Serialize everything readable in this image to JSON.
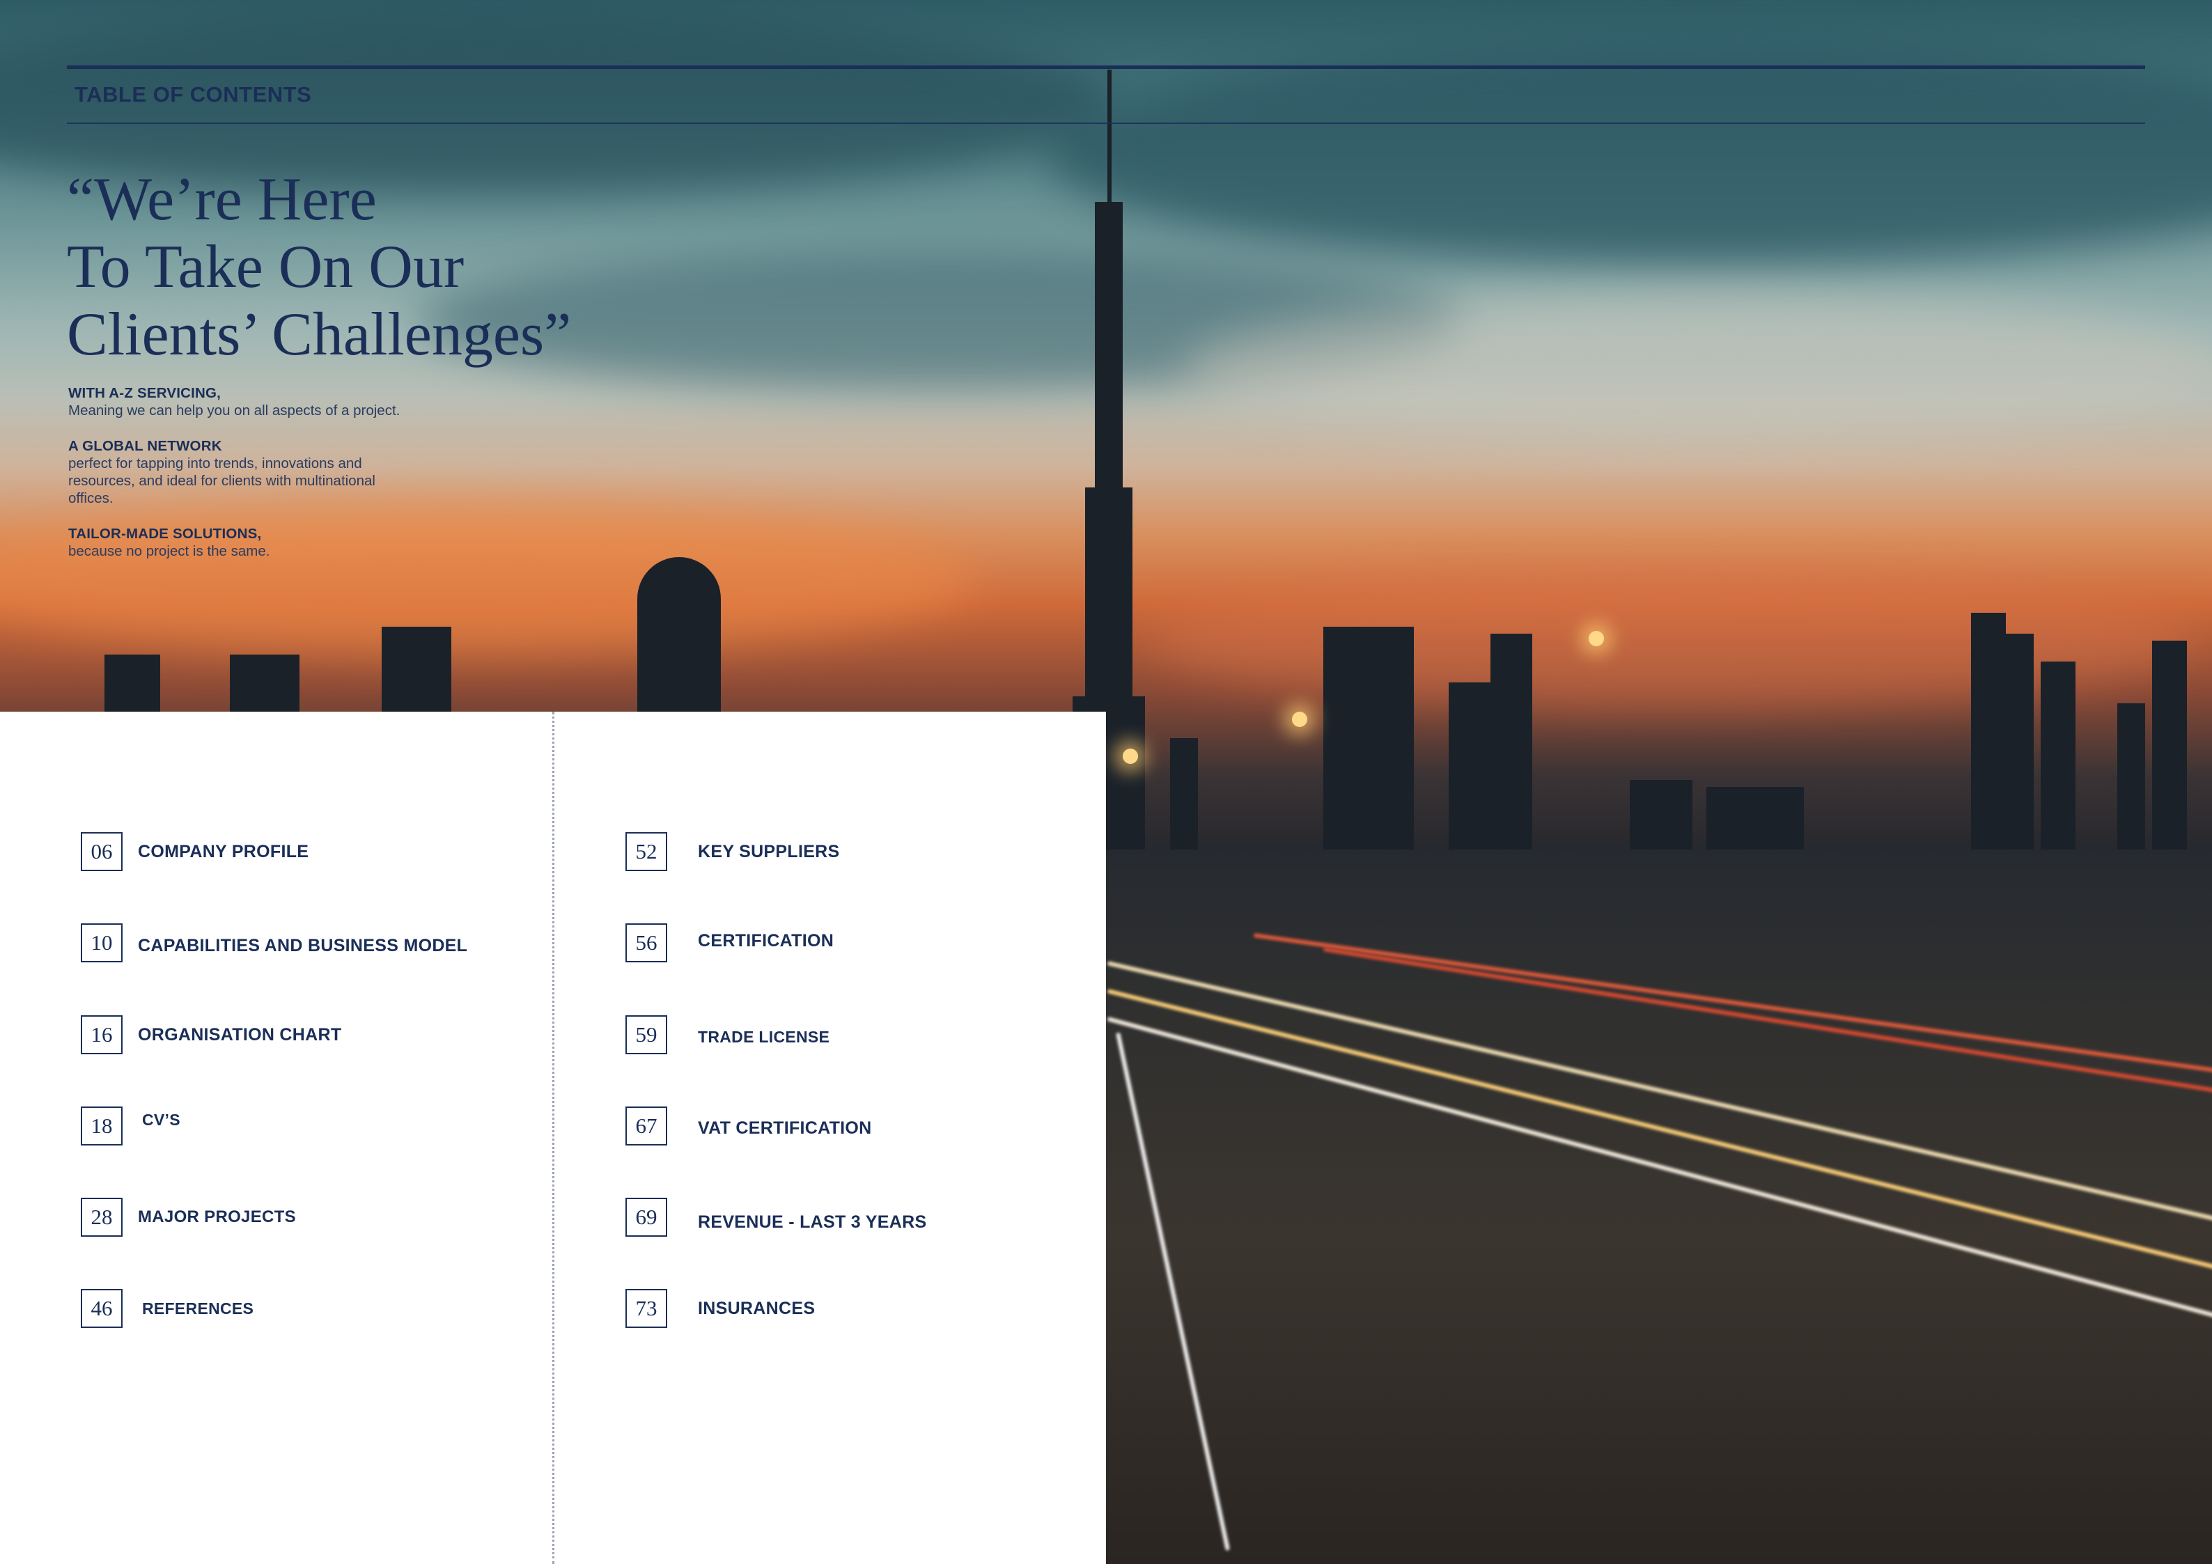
{
  "header": {
    "title": "TABLE OF CONTENTS"
  },
  "headline": {
    "lines": [
      "“We’re Here",
      "To Take On Our",
      "Clients’ Challenges”"
    ]
  },
  "features": [
    {
      "title": "WITH A-Z SERVICING,",
      "lines": [
        "Meaning we can help  you on all aspects of a project."
      ]
    },
    {
      "title": "A GLOBAL NETWORK",
      "lines": [
        "perfect for tapping into trends, innovations and",
        "resources, and ideal for clients with multinational",
        "offices."
      ]
    },
    {
      "title": "TAILOR-MADE SOLUTIONS,",
      "lines": [
        "because no project is the same."
      ]
    }
  ],
  "toc": {
    "left": [
      {
        "page": "06",
        "label": "COMPANY PROFILE"
      },
      {
        "page": "10",
        "label": "CAPABILITIES AND BUSINESS MODEL"
      },
      {
        "page": "16",
        "label": "ORGANISATION CHART"
      },
      {
        "page": "18",
        "label": "CV’S"
      },
      {
        "page": "28",
        "label": "MAJOR PROJECTS"
      },
      {
        "page": "46",
        "label": "REFERENCES"
      }
    ],
    "right": [
      {
        "page": "52",
        "label": "KEY SUPPLIERS"
      },
      {
        "page": "56",
        "label": "CERTIFICATION"
      },
      {
        "page": "59",
        "label": "TRADE LICENSE"
      },
      {
        "page": "67",
        "label": "VAT CERTIFICATION"
      },
      {
        "page": "69",
        "label": "REVENUE - LAST 3 YEARS"
      },
      {
        "page": "73",
        "label": "INSURANCES"
      }
    ]
  },
  "colors": {
    "navy": "#1a2e57",
    "panel": "#ffffff"
  },
  "background_image": "city-skyline-sunset-photo"
}
